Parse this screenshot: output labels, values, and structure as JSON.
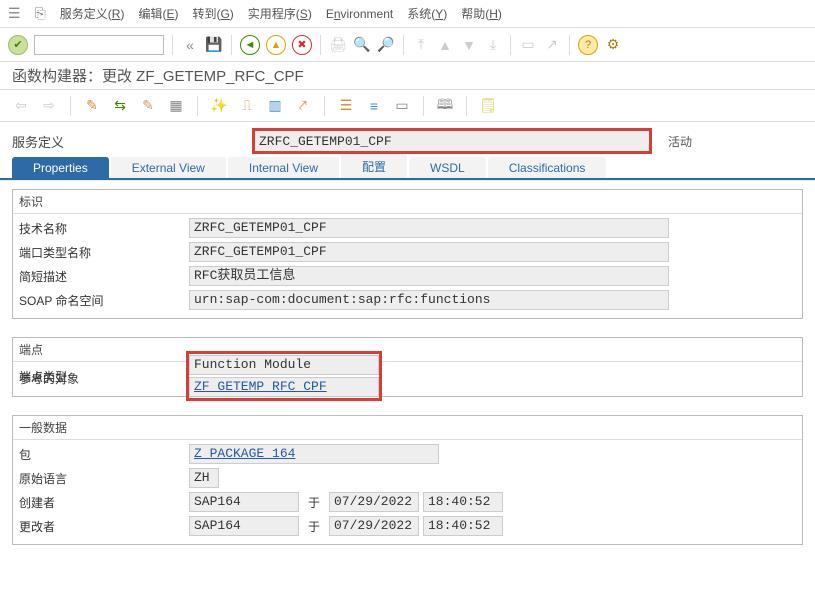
{
  "menubar": {
    "items": [
      {
        "pre": "服务定义(",
        "u": "R",
        "post": ")"
      },
      {
        "pre": "编辑(",
        "u": "E",
        "post": ")"
      },
      {
        "pre": "转到(",
        "u": "G",
        "post": ")"
      },
      {
        "pre": "实用程序(",
        "u": "S",
        "post": ")"
      },
      {
        "pre": "E",
        "u": "n",
        "post": "vironment"
      },
      {
        "pre": "系统(",
        "u": "Y",
        "post": ")"
      },
      {
        "pre": "帮助(",
        "u": "H",
        "post": ")"
      }
    ]
  },
  "titlebar": "函数构建器：更改 ZF_GETEMP_RFC_CPF",
  "svc": {
    "label": "服务定义",
    "value": "ZRFC_GETEMP01_CPF",
    "status": "活动"
  },
  "tabs": [
    "Properties",
    "External View",
    "Internal View",
    "配置",
    "WSDL",
    "Classifications"
  ],
  "activeTabIndex": 0,
  "group_ident": {
    "title": "标识",
    "rows": {
      "tech_name": {
        "label": "技术名称",
        "value": "ZRFC_GETEMP01_CPF"
      },
      "port_type": {
        "label": "端口类型名称",
        "value": "ZRFC_GETEMP01_CPF"
      },
      "short_desc": {
        "label": "简短描述",
        "value": "RFC获取员工信息"
      },
      "soap_ns": {
        "label": "SOAP 命名空间",
        "value": "urn:sap-com:document:sap:rfc:functions"
      }
    }
  },
  "group_endpoint": {
    "title": "端点",
    "rows": {
      "ep_type": {
        "label": "端点类型",
        "value": "Function Module"
      },
      "ref_obj": {
        "label": "参考的对象",
        "value": "ZF_GETEMP_RFC_CPF"
      }
    }
  },
  "group_general": {
    "title": "一般数据",
    "rows": {
      "pkg": {
        "label": "包",
        "value": "Z_PACKAGE_164"
      },
      "lang": {
        "label": "原始语言",
        "value": "ZH"
      },
      "created": {
        "label": "创建者",
        "value": "SAP164",
        "on": "于",
        "date": "07/29/2022",
        "time": "18:40:52"
      },
      "changed": {
        "label": "更改者",
        "value": "SAP164",
        "on": "于",
        "date": "07/29/2022",
        "time": "18:40:52"
      }
    }
  }
}
